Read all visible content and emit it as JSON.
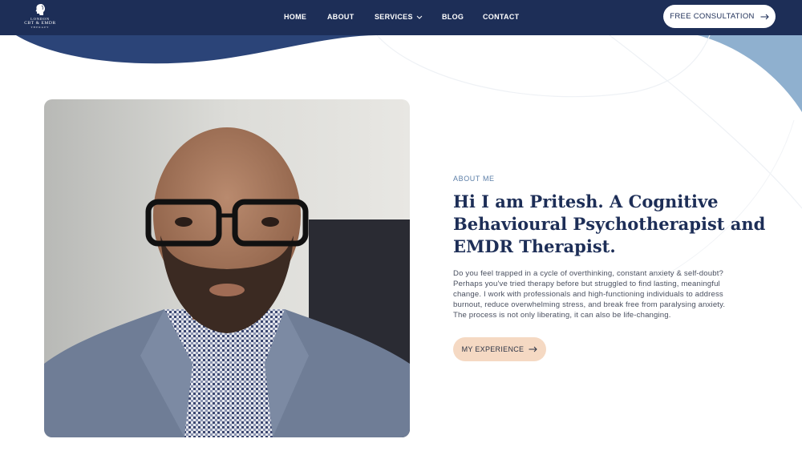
{
  "brand": {
    "line1": "LONDON",
    "line2": "CBT & EMDR",
    "line3": "THERAPY",
    "icon": "head-profile-logo-icon"
  },
  "nav": {
    "items": [
      {
        "label": "HOME"
      },
      {
        "label": "ABOUT"
      },
      {
        "label": "SERVICES",
        "icon": "chevron-down-icon"
      },
      {
        "label": "BLOG"
      },
      {
        "label": "CONTACT"
      }
    ],
    "cta_label": "FREE CONSULTATION",
    "cta_icon": "arrow-right-icon"
  },
  "about": {
    "eyebrow": "ABOUT ME",
    "heading_lines": [
      "Hi I am Pritesh. A Cognitive",
      "Behavioural Psychotherapist and",
      "EMDR Therapist."
    ],
    "body_lines": [
      "Do you feel trapped in a cycle of overthinking, constant anxiety & self-doubt?",
      "Perhaps you've tried therapy before but struggled to find lasting, meaningful",
      "change. I work with professionals and high-functioning individuals to address",
      "burnout, reduce overwhelming stress, and break free from paralysing anxiety.",
      "The process is not only liberating, it can also be life-changing."
    ],
    "button_label": "MY EXPERIENCE",
    "button_icon": "arrow-right-icon"
  },
  "colors": {
    "navy": "#1d2e57",
    "accent_blue": "#5d7fa8",
    "light_blue": "#8fb0cf",
    "peach": "#f5d9c3"
  }
}
